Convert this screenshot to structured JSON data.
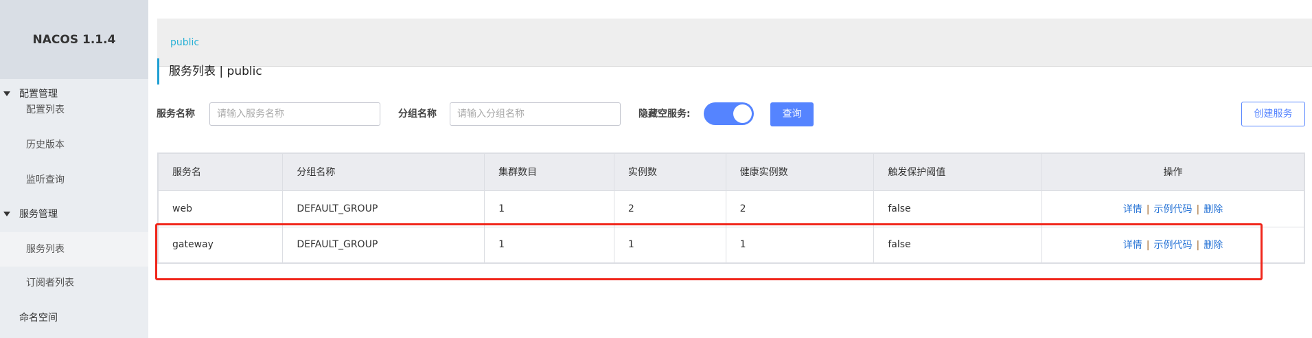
{
  "sidebar": {
    "logo": "NACOS 1.1.4",
    "items": [
      {
        "label": "配置管理",
        "type": "group"
      },
      {
        "label": "配置列表",
        "type": "sub"
      },
      {
        "label": "历史版本",
        "type": "sub"
      },
      {
        "label": "监听查询",
        "type": "sub"
      },
      {
        "label": "服务管理",
        "type": "group"
      },
      {
        "label": "服务列表",
        "type": "sub",
        "active": true
      },
      {
        "label": "订阅者列表",
        "type": "sub"
      },
      {
        "label": "命名空间",
        "type": "plain"
      }
    ]
  },
  "breadcrumb": "public",
  "title": "服务列表 | public",
  "filters": {
    "service_label": "服务名称",
    "service_placeholder": "请输入服务名称",
    "group_label": "分组名称",
    "group_placeholder": "请输入分组名称",
    "hide_empty_label": "隐藏空服务:",
    "hide_empty_on": true,
    "query_button": "查询",
    "create_button": "创建服务"
  },
  "table": {
    "headers": [
      "服务名",
      "分组名称",
      "集群数目",
      "实例数",
      "健康实例数",
      "触发保护阈值",
      "操作"
    ],
    "rows": [
      [
        "web",
        "DEFAULT_GROUP",
        "1",
        "2",
        "2",
        "false"
      ],
      [
        "gateway",
        "DEFAULT_GROUP",
        "1",
        "1",
        "1",
        "false"
      ]
    ],
    "actions": [
      "详情",
      "示例代码",
      "删除"
    ],
    "sep": "|"
  },
  "colors": {
    "accent": "#5584ff",
    "highlight": "#f0261b",
    "link": "#2a75d6"
  }
}
